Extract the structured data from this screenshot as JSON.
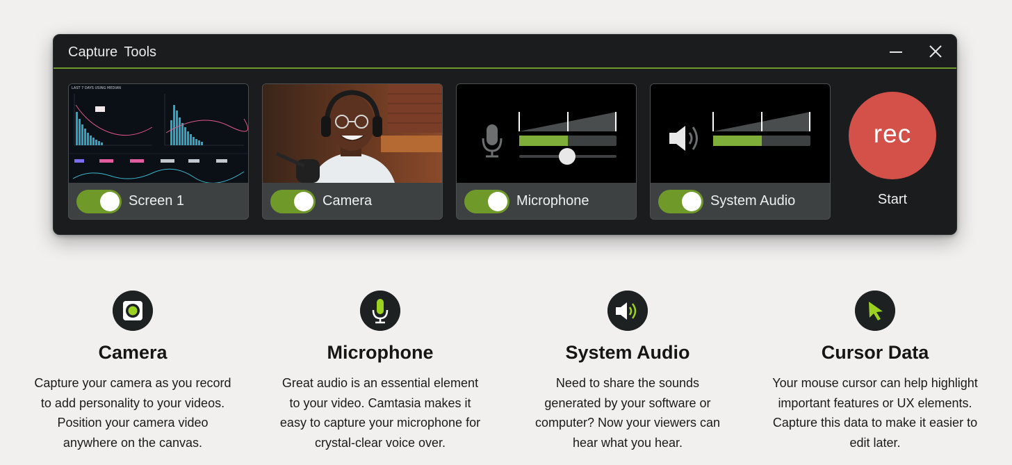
{
  "window": {
    "title": "Capture  Tools",
    "minimize_icon": "minimize-icon",
    "close_icon": "close-icon",
    "accent_color": "#6f9a2a"
  },
  "sources": [
    {
      "label": "Screen 1",
      "enabled": true,
      "preview": "screen-dashboard-thumbnail"
    },
    {
      "label": "Camera",
      "enabled": true,
      "preview": "camera-person-thumbnail"
    },
    {
      "label": "Microphone",
      "enabled": true,
      "preview": "microphone-level-meter",
      "level": 0.5,
      "volume": 0.45
    },
    {
      "label": "System Audio",
      "enabled": true,
      "preview": "system-audio-level-meter",
      "level": 0.5
    }
  ],
  "record": {
    "button_label": "rec",
    "caption": "Start",
    "color": "#d4514a"
  },
  "dashboard_text": {
    "tab_label": "LAST 7 DAYS USING MEDIAN"
  },
  "features": [
    {
      "icon": "camera-icon",
      "title": "Camera",
      "description": "Capture your camera as you record to add personality to your videos. Position your camera video anywhere on the canvas."
    },
    {
      "icon": "microphone-icon",
      "title": "Microphone",
      "description": "Great audio is an essential element to your video. Camtasia makes it easy to capture your microphone for crystal-clear voice over."
    },
    {
      "icon": "speaker-icon",
      "title": "System Audio",
      "description": "Need to share the sounds generated by your software or computer? Now your viewers can hear what you hear."
    },
    {
      "icon": "cursor-icon",
      "title": "Cursor Data",
      "description": "Your mouse cursor can help highlight important features or UX elements. Capture this data to make it easier to edit later."
    }
  ]
}
